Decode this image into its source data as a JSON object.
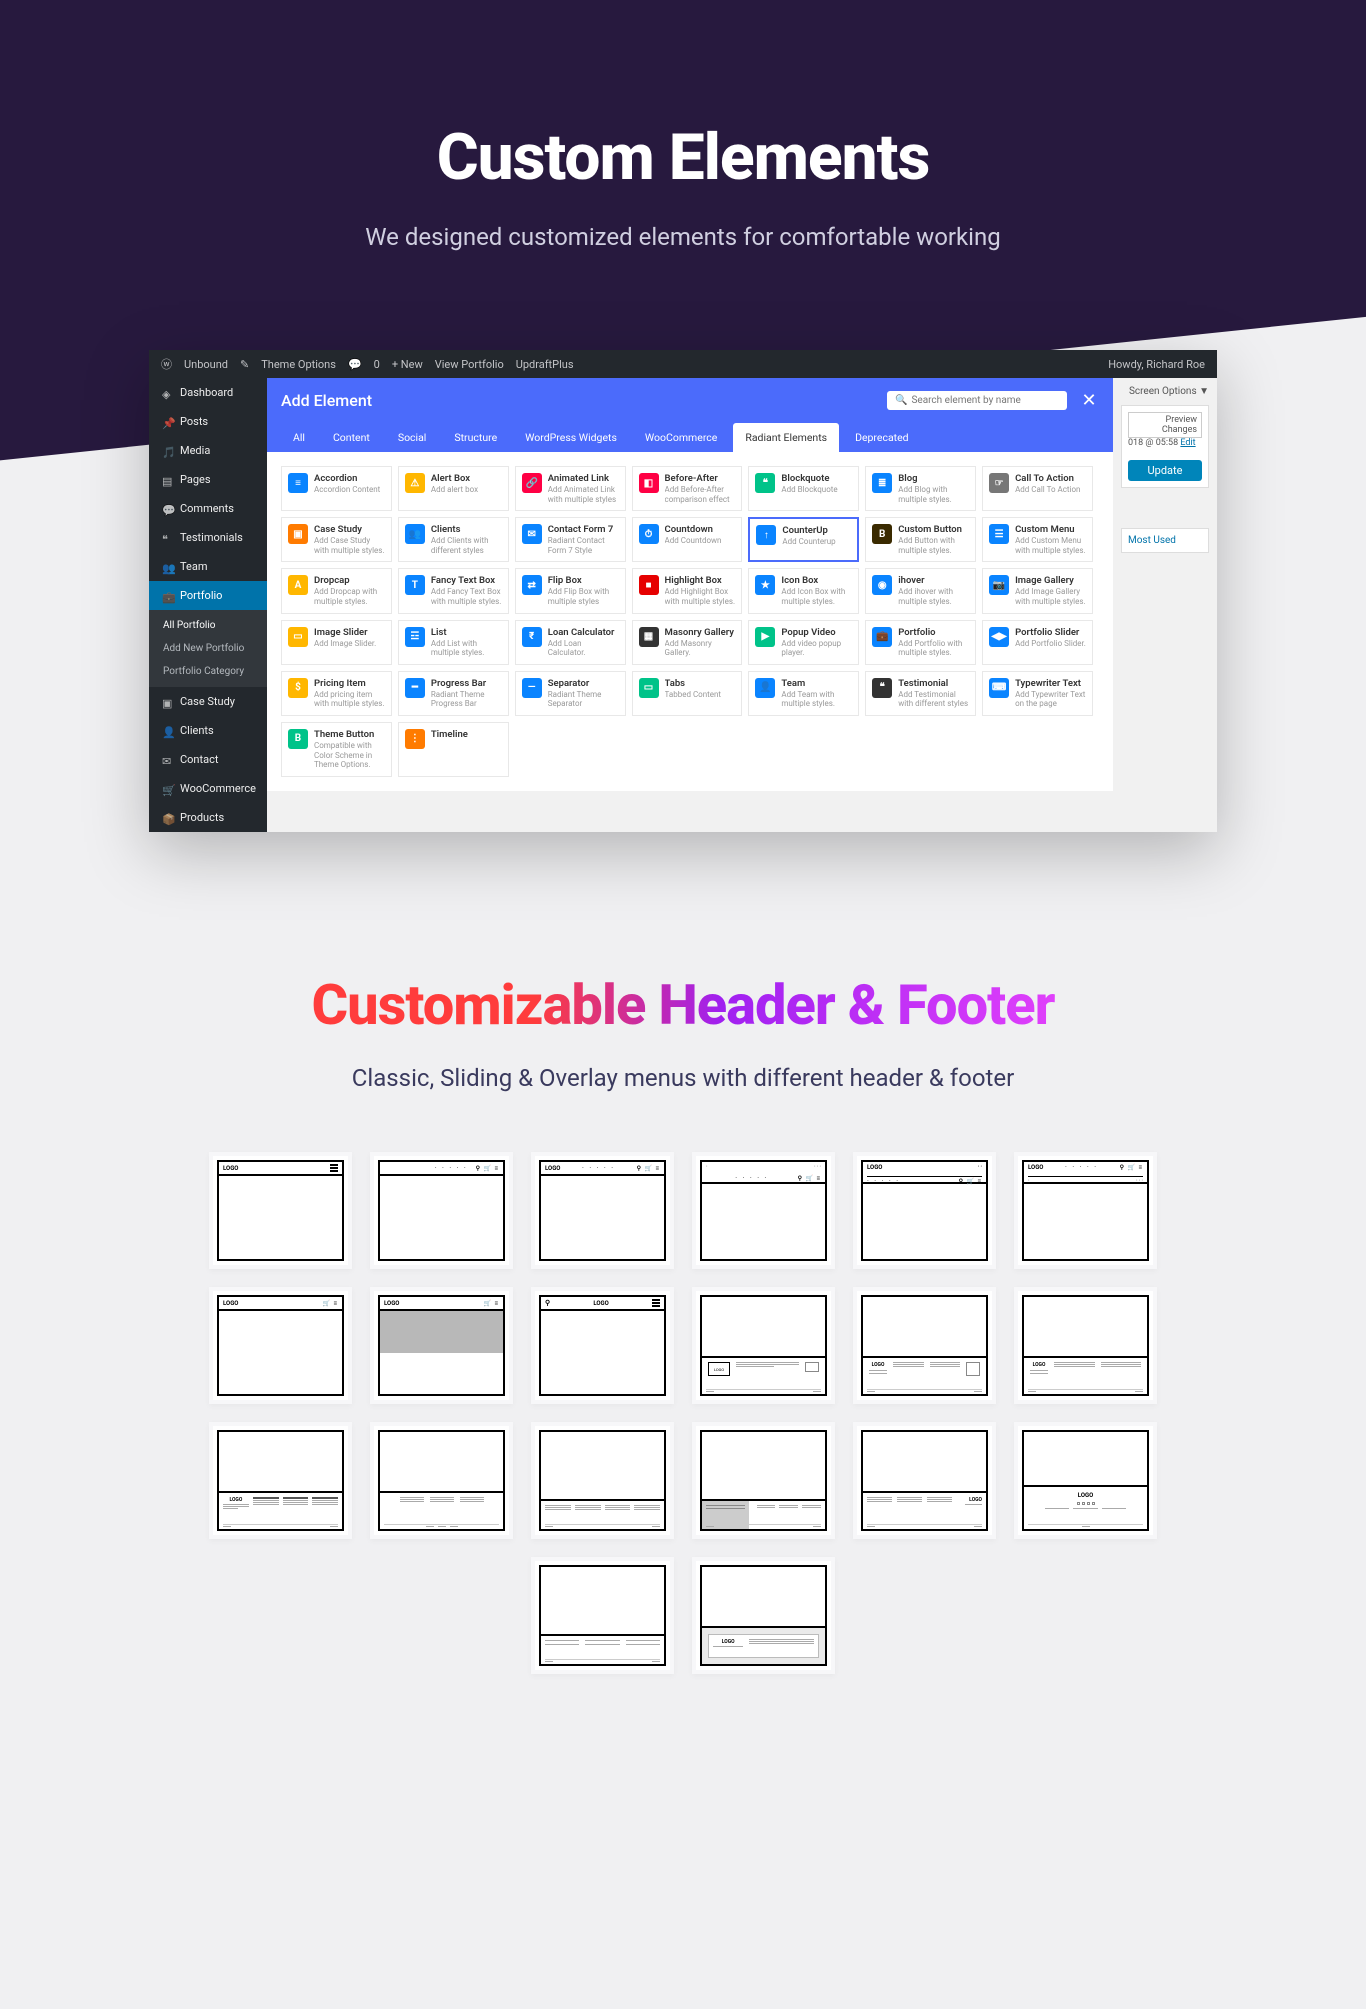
{
  "hero": {
    "title": "Custom Elements",
    "subtitle": "We designed customized elements for comfortable working"
  },
  "wp": {
    "topbar": {
      "site": "Unbound",
      "themeopts": "Theme Options",
      "comments": "0",
      "new": "+ New",
      "view": "View Portfolio",
      "updraft": "UpdraftPlus",
      "howdy": "Howdy, Richard Roe"
    },
    "menu": [
      "Dashboard",
      "Posts",
      "Media",
      "Pages",
      "Comments",
      "Testimonials",
      "Team",
      "Portfolio",
      "Case Study",
      "Clients",
      "Contact",
      "WooCommerce",
      "Products"
    ],
    "submenu": [
      "All Portfolio",
      "Add New Portfolio",
      "Portfolio Category"
    ],
    "right": {
      "screen": "Screen Options ▼",
      "preview": "Preview Changes",
      "date": "018 @ 05:58",
      "edit": "Edit",
      "update": "Update",
      "mostused": "Most Used"
    }
  },
  "modal": {
    "title": "Add Element",
    "search": "Search element by name",
    "tabs": [
      "All",
      "Content",
      "Social",
      "Structure",
      "WordPress Widgets",
      "WooCommerce",
      "Radiant Elements",
      "Deprecated"
    ],
    "activeTab": 6
  },
  "elements": [
    {
      "t": "Accordion",
      "d": "Accordion Content",
      "c": "#0a84ff",
      "i": "≡"
    },
    {
      "t": "Alert Box",
      "d": "Add alert box",
      "c": "#ffb700",
      "i": "⚠"
    },
    {
      "t": "Animated Link",
      "d": "Add Animated Link with multiple styles",
      "c": "#ff0044",
      "i": "🔗"
    },
    {
      "t": "Before-After",
      "d": "Add Before-After comparison effect",
      "c": "#ff0044",
      "i": "◧"
    },
    {
      "t": "Blockquote",
      "d": "Add Blockquote",
      "c": "#00c389",
      "i": "❝"
    },
    {
      "t": "Blog",
      "d": "Add Blog with multiple styles.",
      "c": "#0a84ff",
      "i": "≣"
    },
    {
      "t": "Call To Action",
      "d": "Add Call To Action",
      "c": "#777",
      "i": "☞"
    },
    {
      "t": "Case Study",
      "d": "Add Case Study with multiple styles.",
      "c": "#ff7b00",
      "i": "▣"
    },
    {
      "t": "Clients",
      "d": "Add Clients with different styles",
      "c": "#0a84ff",
      "i": "👥"
    },
    {
      "t": "Contact Form 7",
      "d": "Radiant Contact Form 7 Style",
      "c": "#0a84ff",
      "i": "✉"
    },
    {
      "t": "Countdown",
      "d": "Add Countdown",
      "c": "#0a84ff",
      "i": "⏱"
    },
    {
      "t": "CounterUp",
      "d": "Add Counterup",
      "c": "#0a84ff",
      "i": "↑",
      "sel": true
    },
    {
      "t": "Custom Button",
      "d": "Add Button with multiple styles.",
      "c": "#3a2a00",
      "i": "B"
    },
    {
      "t": "Custom Menu",
      "d": "Add Custom Menu with multiple styles.",
      "c": "#0a84ff",
      "i": "☰"
    },
    {
      "t": "Dropcap",
      "d": "Add Dropcap with multiple styles.",
      "c": "#ffb700",
      "i": "A"
    },
    {
      "t": "Fancy Text Box",
      "d": "Add Fancy Text Box with multiple styles.",
      "c": "#0a84ff",
      "i": "T"
    },
    {
      "t": "Flip Box",
      "d": "Add Flip Box with multiple styles",
      "c": "#0a84ff",
      "i": "⇄"
    },
    {
      "t": "Highlight Box",
      "d": "Add Highlight Box with multiple styles.",
      "c": "#e60000",
      "i": "■"
    },
    {
      "t": "Icon Box",
      "d": "Add Icon Box with multiple styles.",
      "c": "#0a84ff",
      "i": "★"
    },
    {
      "t": "ihover",
      "d": "Add ihover with multiple styles.",
      "c": "#0a84ff",
      "i": "◉"
    },
    {
      "t": "Image Gallery",
      "d": "Add Image Gallery with multiple styles.",
      "c": "#0a84ff",
      "i": "📷"
    },
    {
      "t": "Image Slider",
      "d": "Add Image Slider.",
      "c": "#ffb700",
      "i": "▭"
    },
    {
      "t": "List",
      "d": "Add List with multiple styles.",
      "c": "#0a84ff",
      "i": "☲"
    },
    {
      "t": "Loan Calculator",
      "d": "Add Loan Calculator.",
      "c": "#0a84ff",
      "i": "₹"
    },
    {
      "t": "Masonry Gallery",
      "d": "Add Masonry Gallery.",
      "c": "#333",
      "i": "▦"
    },
    {
      "t": "Popup Video",
      "d": "Add video popup player.",
      "c": "#00c389",
      "i": "▶"
    },
    {
      "t": "Portfolio",
      "d": "Add Portfolio with multiple styles.",
      "c": "#0a84ff",
      "i": "💼"
    },
    {
      "t": "Portfolio Slider",
      "d": "Add Portfolio Slider.",
      "c": "#0a84ff",
      "i": "◀▶"
    },
    {
      "t": "Pricing Item",
      "d": "Add pricing item with multiple styles.",
      "c": "#ffb700",
      "i": "$"
    },
    {
      "t": "Progress Bar",
      "d": "Radiant Theme Progress Bar",
      "c": "#0a84ff",
      "i": "━"
    },
    {
      "t": "Separator",
      "d": "Radiant Theme Separator",
      "c": "#0a84ff",
      "i": "—"
    },
    {
      "t": "Tabs",
      "d": "Tabbed Content",
      "c": "#00c389",
      "i": "▭"
    },
    {
      "t": "Team",
      "d": "Add Team with multiple styles.",
      "c": "#0a84ff",
      "i": "👤"
    },
    {
      "t": "Testimonial",
      "d": "Add Testimonial with different styles",
      "c": "#333",
      "i": "❝"
    },
    {
      "t": "Typewriter Text",
      "d": "Add Typewriter Text on the page",
      "c": "#0a84ff",
      "i": "⌨"
    },
    {
      "t": "Theme Button",
      "d": "Compatible with Color Scheme in Theme Options.",
      "c": "#00c389",
      "i": "B"
    },
    {
      "t": "Timeline",
      "d": "",
      "c": "#ff7b00",
      "i": "⋮"
    }
  ],
  "section2": {
    "title": "Customizable Header & Footer",
    "subtitle": "Classic, Sliding & Overlay menus with different header & footer"
  }
}
